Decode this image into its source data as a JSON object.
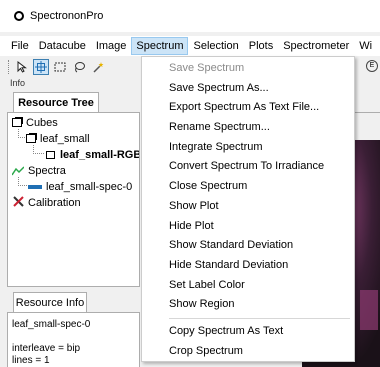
{
  "window": {
    "title": "SpectrononPro"
  },
  "menubar": {
    "items": [
      {
        "label": "File",
        "active": false
      },
      {
        "label": "Datacube",
        "active": false
      },
      {
        "label": "Image",
        "active": false
      },
      {
        "label": "Spectrum",
        "active": true
      },
      {
        "label": "Selection",
        "active": false
      },
      {
        "label": "Plots",
        "active": false
      },
      {
        "label": "Spectrometer",
        "active": false
      },
      {
        "label": "Wi",
        "active": false
      }
    ]
  },
  "toolbar": {
    "tools": [
      {
        "icon": "pointer-icon"
      },
      {
        "icon": "crosshair-icon",
        "active": true
      },
      {
        "icon": "rectangle-select-icon"
      },
      {
        "icon": "lasso-icon"
      },
      {
        "icon": "magic-wand-icon"
      }
    ]
  },
  "left_panel": {
    "info_label": "Info",
    "resource_tree_tab": "Resource Tree",
    "tree": [
      {
        "label": "Cubes",
        "icon": "cube-icon"
      },
      {
        "label": "leaf_small",
        "icon": "cube-icon"
      },
      {
        "label": "leaf_small-RGB",
        "icon": "image-icon"
      },
      {
        "label": "Spectra",
        "icon": "spectra-icon"
      },
      {
        "label": "leaf_small-spec-0",
        "icon": "spectrum-line-icon"
      },
      {
        "label": "Calibration",
        "icon": "calibration-icon"
      }
    ],
    "resource_info_tab": "Resource Info",
    "resource_info": {
      "name": "leaf_small-spec-0",
      "interleave": "interleave = bip",
      "lines": "lines = 1"
    }
  },
  "spectrum_menu": {
    "items": [
      {
        "label": "Save Spectrum",
        "disabled": true
      },
      {
        "label": "Save Spectrum As..."
      },
      {
        "label": "Export Spectrum As Text File..."
      },
      {
        "label": "Rename Spectrum..."
      },
      {
        "label": "Integrate Spectrum"
      },
      {
        "label": "Convert Spectrum To Irradiance"
      },
      {
        "label": "Close Spectrum"
      },
      {
        "label": "Show Plot"
      },
      {
        "label": "Hide Plot"
      },
      {
        "label": "Show Standard Deviation"
      },
      {
        "label": "Hide Standard Deviation"
      },
      {
        "label": "Set Label Color"
      },
      {
        "label": "Show Region"
      },
      {
        "label": "Copy Spectrum As Text"
      },
      {
        "label": "Crop Spectrum"
      }
    ]
  }
}
